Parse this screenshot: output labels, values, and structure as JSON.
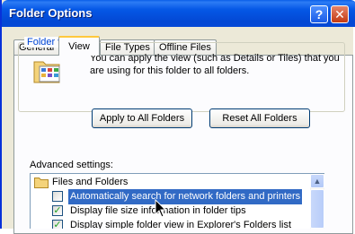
{
  "window": {
    "title": "Folder Options",
    "help_glyph": "?",
    "close_glyph": "✕"
  },
  "tabs": [
    {
      "label": "General",
      "active": false
    },
    {
      "label": "View",
      "active": true
    },
    {
      "label": "File Types",
      "active": false
    },
    {
      "label": "Offline Files",
      "active": false
    }
  ],
  "folder_views": {
    "label": "Folder views",
    "description": "You can apply the view (such as Details or Tiles) that you are using for this folder to all folders.",
    "apply_button": "Apply to All Folders",
    "reset_button": "Reset All Folders"
  },
  "advanced": {
    "label": "Advanced settings:",
    "items": [
      {
        "text": "Files and Folders",
        "type": "folder"
      },
      {
        "text": "Automatically search for network folders and printers",
        "type": "checkbox",
        "checked": false,
        "selected": true
      },
      {
        "text": "Display file size information in folder tips",
        "type": "checkbox",
        "checked": true,
        "selected": false
      },
      {
        "text": "Display simple folder view in Explorer's Folders list",
        "type": "checkbox",
        "checked": true,
        "selected": false
      }
    ],
    "check_glyph": "✓",
    "scroll_up_glyph": "▲"
  },
  "colors": {
    "title_bar": "#0558e6",
    "selection": "#316ac5",
    "group_label": "#0046d5"
  }
}
